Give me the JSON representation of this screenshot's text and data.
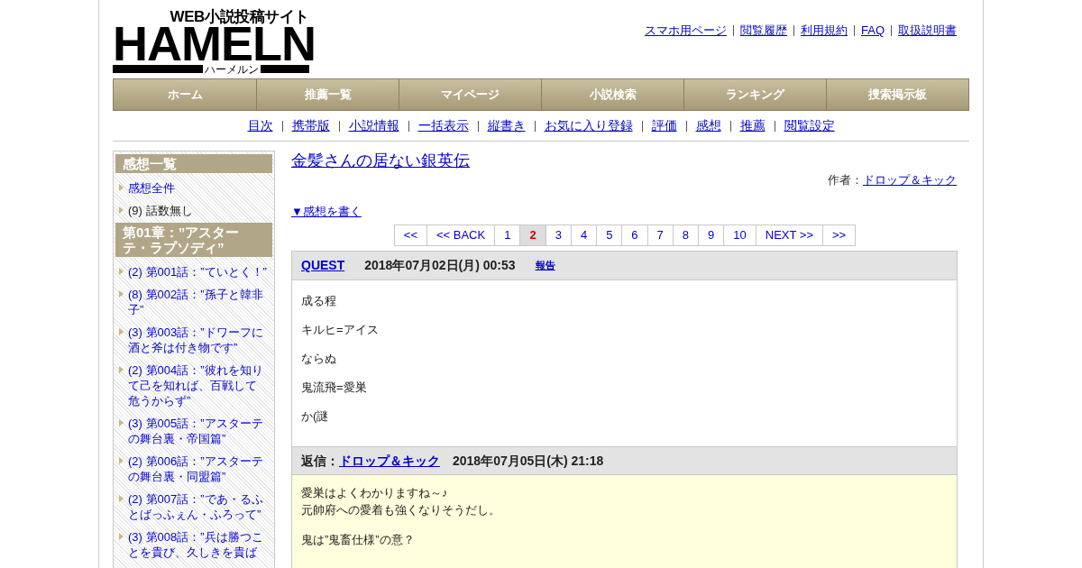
{
  "header": {
    "logo": {
      "tagline": "WEB小説投稿サイト",
      "wordmark": "HAMELN",
      "reading": "ハーメルン"
    },
    "top_links": [
      "スマホ用ページ",
      "閲覧履歴",
      "利用規約",
      "FAQ",
      "取扱説明書"
    ]
  },
  "nav": [
    "ホーム",
    "推薦一覧",
    "マイページ",
    "小説検索",
    "ランキング",
    "捜索掲示板"
  ],
  "sub_nav": [
    "目次",
    "携帯版",
    "小説情報",
    "一括表示",
    "縦書き",
    "お気に入り登録",
    "評価",
    "感想",
    "推薦",
    "閲覧設定"
  ],
  "sidebar": {
    "sections": [
      {
        "title": "感想一覧",
        "items": [
          {
            "kind": "link",
            "text": "感想全件"
          },
          {
            "kind": "plain",
            "text": "(9) 話数無し"
          }
        ]
      },
      {
        "title": "第01章：”アスターテ・ラプソディ”",
        "items": [
          {
            "kind": "link",
            "text": "(2) 第001話：”ていとく！”"
          },
          {
            "kind": "link",
            "text": "(8) 第002話：”孫子と韓非子”"
          },
          {
            "kind": "link",
            "text": "(3) 第003話：”ドワーフに酒と斧は付き物です”"
          },
          {
            "kind": "link",
            "text": "(2) 第004話：”彼れを知りて己を知れば、百戦して危うからず”"
          },
          {
            "kind": "link",
            "text": "(3) 第005話：”アスターテの舞台裏・帝国篇”"
          },
          {
            "kind": "link",
            "text": "(2) 第006話：”アスターテの舞台裏・同盟篇”"
          },
          {
            "kind": "link",
            "text": "(2) 第007話：”であ・るふとばっふぇん・ふろって”"
          },
          {
            "kind": "link",
            "text": "(3) 第008話：”兵は勝つことを貴び、久しきを貴ば"
          }
        ]
      }
    ]
  },
  "novel": {
    "title": "金髪さんの居ない銀英伝",
    "author_label": "作者：",
    "author": "ドロップ＆キック"
  },
  "write_link": "▼感想を書く",
  "pagination": [
    {
      "label": "<<",
      "selected": false
    },
    {
      "label": "<< BACK",
      "selected": false
    },
    {
      "label": "1",
      "selected": false
    },
    {
      "label": "2",
      "selected": true
    },
    {
      "label": "3",
      "selected": false
    },
    {
      "label": "4",
      "selected": false
    },
    {
      "label": "5",
      "selected": false
    },
    {
      "label": "6",
      "selected": false
    },
    {
      "label": "7",
      "selected": false
    },
    {
      "label": "8",
      "selected": false
    },
    {
      "label": "9",
      "selected": false
    },
    {
      "label": "10",
      "selected": false
    },
    {
      "label": "NEXT >>",
      "selected": false
    },
    {
      "label": ">>",
      "selected": false
    }
  ],
  "comments": [
    {
      "user": "QUEST",
      "date": "2018年07月02日(月) 00:53",
      "report": "報告",
      "paragraphs": [
        [
          "成る程"
        ],
        [
          "キルヒ=アイス"
        ],
        [
          "ならぬ"
        ],
        [
          "鬼流飛=愛巣"
        ],
        [
          "か(謎"
        ]
      ],
      "reply": {
        "label": "返信：",
        "user": "ドロップ＆キック",
        "date": "2018年07月05日(木) 21:18",
        "paragraphs": [
          [
            "愛巣はよくわかりますね～♪",
            "元帥府への愛着も強くなりそうだし。"
          ],
          [
            "鬼は”鬼畜仕様”の意？"
          ]
        ]
      }
    }
  ]
}
